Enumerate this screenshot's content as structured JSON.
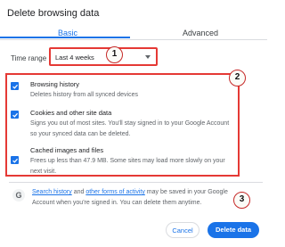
{
  "dialog": {
    "title": "Delete browsing data"
  },
  "tabs": [
    {
      "label": "Basic",
      "active": true
    },
    {
      "label": "Advanced",
      "active": false
    }
  ],
  "time_range": {
    "label": "Time range",
    "value": "Last 4 weeks"
  },
  "options": [
    {
      "title": "Browsing history",
      "description": [
        "Deletes history from all synced devices"
      ],
      "checked": true
    },
    {
      "title": "Cookies and other site data",
      "description": [
        "Signs you out of most sites. You'll stay signed in to your Google Account",
        "so your synced data can be deleted."
      ],
      "checked": true
    },
    {
      "title": "Cached images and files",
      "description": [
        "Frees up less than 47.9 MB. Some sites may load more slowly on your",
        "next visit."
      ],
      "checked": true
    }
  ],
  "info": {
    "icon": "G",
    "link1": "Search history",
    "mid1": " and ",
    "link2": "other forms of activity",
    "rest1": " may be saved in your Google",
    "line2": "Account when you're signed in. You can delete them anytime."
  },
  "buttons": {
    "cancel": "Cancel",
    "delete": "Delete data"
  },
  "annotations": [
    "1",
    "2",
    "3"
  ],
  "colors": {
    "accent": "#1a73e8",
    "highlight": "#e53935"
  }
}
